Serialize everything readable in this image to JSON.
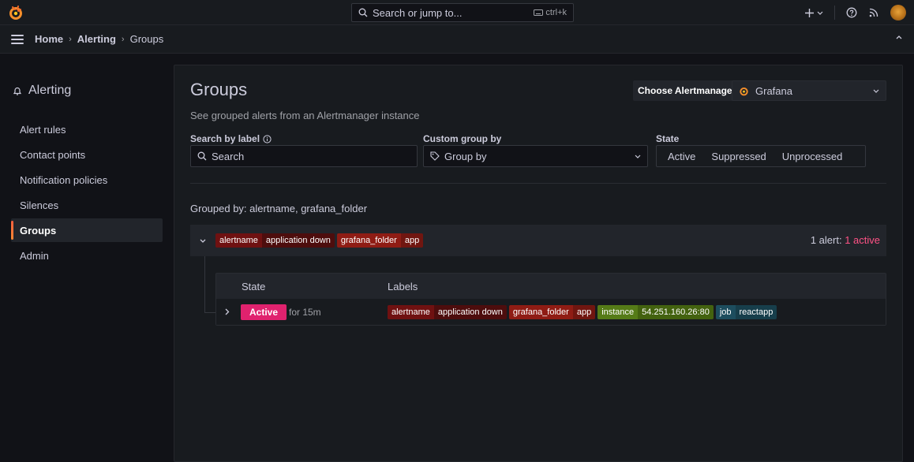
{
  "topbar": {
    "search_placeholder": "Search or jump to...",
    "shortcut": "ctrl+k"
  },
  "breadcrumb": [
    "Home",
    "Alerting",
    "Groups"
  ],
  "sidebar": {
    "title": "Alerting",
    "items": [
      {
        "label": "Alert rules",
        "active": false
      },
      {
        "label": "Contact points",
        "active": false
      },
      {
        "label": "Notification policies",
        "active": false
      },
      {
        "label": "Silences",
        "active": false
      },
      {
        "label": "Groups",
        "active": true
      },
      {
        "label": "Admin",
        "active": false
      }
    ]
  },
  "page": {
    "title": "Groups",
    "subtitle": "See grouped alerts from an Alertmanager instance",
    "alertmanager_label": "Choose Alertmanager",
    "alertmanager_value": "Grafana"
  },
  "filters": {
    "search_label": "Search by label",
    "search_placeholder": "Search",
    "group_label": "Custom group by",
    "group_placeholder": "Group by",
    "state_label": "State",
    "state_options": [
      "Active",
      "Suppressed",
      "Unprocessed"
    ]
  },
  "grouped_by": "Grouped by: alertname, grafana_folder",
  "group": {
    "labels": [
      {
        "key": "alertname",
        "value": "application down"
      },
      {
        "key": "grafana_folder",
        "value": "app"
      }
    ],
    "count_prefix": "1 alert: ",
    "count_active": "1 active"
  },
  "table": {
    "col_state": "State",
    "col_labels": "Labels",
    "row": {
      "state": "Active",
      "duration": "for 15m",
      "labels": [
        {
          "key": "alertname",
          "value": "application down"
        },
        {
          "key": "grafana_folder",
          "value": "app"
        },
        {
          "key": "instance",
          "value": "54.251.160.26:80"
        },
        {
          "key": "job",
          "value": "reactapp"
        }
      ]
    }
  },
  "colors": {
    "accent": "#ff8833",
    "active_badge": "#e0226e",
    "active_text": "#ff5286"
  }
}
